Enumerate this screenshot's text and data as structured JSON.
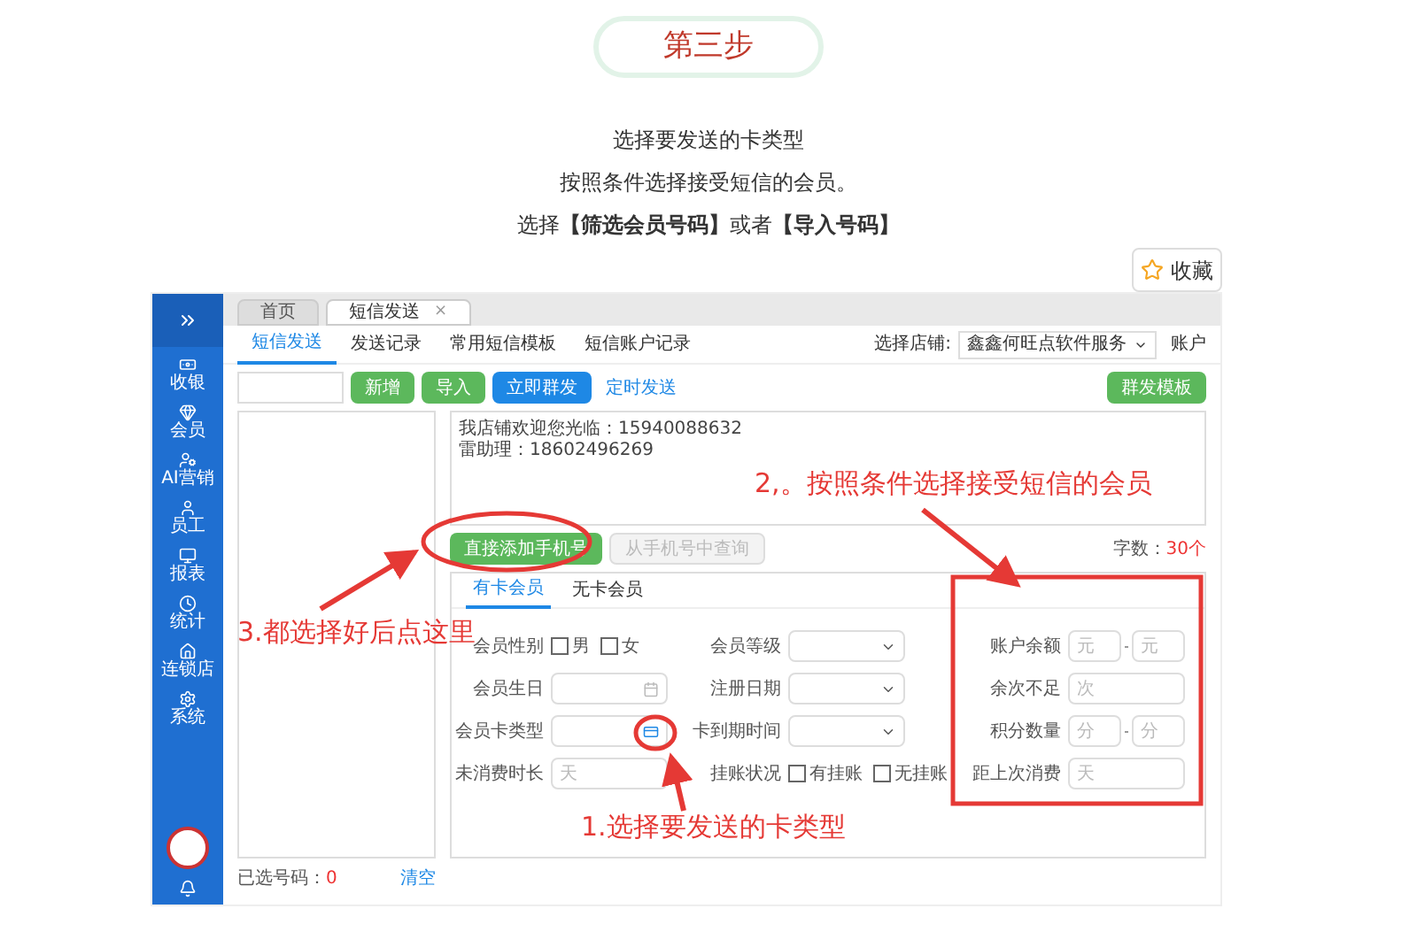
{
  "step_badge": {
    "label": "第三步"
  },
  "instructions": [
    "选择要发送的卡类型",
    "按照条件选择接受短信的会员。",
    "选择**【筛选会员号码】**或者**【导入号码】**"
  ],
  "favorite_button": {
    "label": "收藏"
  },
  "screenshot": {
    "sidebar": [
      "收银",
      "会员",
      "AI营销",
      "员工",
      "报表",
      "统计",
      "连锁店",
      "系统"
    ],
    "tabs": [
      {
        "label": "首页",
        "selected": false
      },
      {
        "label": "短信发送",
        "selected": true,
        "close": "×"
      }
    ],
    "sub_tabs": [
      {
        "label": "短信发送",
        "selected": true
      },
      {
        "label": "发送记录",
        "selected": false
      },
      {
        "label": "常用短信模板",
        "selected": false
      },
      {
        "label": "短信账户记录",
        "selected": false
      }
    ],
    "store_label": "选择店铺:",
    "store_value": "鑫鑫何旺点软件服务",
    "account_label": "账户",
    "toolbar_buttons": [
      {
        "label": "新增",
        "kind": "green"
      },
      {
        "label": "导入",
        "kind": "green"
      },
      {
        "label": "立即群发",
        "kind": "blue"
      },
      {
        "label": "定时发送",
        "kind": "link"
      }
    ],
    "template_button": {
      "label": "群发模板"
    },
    "message_lines": [
      "我店铺欢迎您光临：15940088632",
      "雷助理：18602496269"
    ],
    "add_buttons": [
      {
        "label": "直接添加手机号",
        "disabled": false
      },
      {
        "label": "从手机号中查询",
        "disabled": true
      }
    ],
    "char_count_label": "字数：",
    "char_count": "30个",
    "member_tabs": [
      {
        "label": "有卡会员",
        "selected": true
      },
      {
        "label": "无卡会员",
        "selected": false
      }
    ],
    "form_columns": [
      [
        {
          "kind": "checkboxes",
          "label": "会员性别",
          "options": [
            {
              "label": "男",
              "checked": false
            },
            {
              "label": "女",
              "checked": false
            }
          ]
        },
        {
          "kind": "date",
          "label": "会员生日"
        },
        {
          "kind": "picker",
          "label": "会员卡类型"
        },
        {
          "kind": "text",
          "label": "未消费时长",
          "placeholder": "天"
        }
      ],
      [
        {
          "kind": "select",
          "label": "会员等级"
        },
        {
          "kind": "select",
          "label": "注册日期"
        },
        {
          "kind": "select",
          "label": "卡到期时间"
        },
        {
          "kind": "checkboxes",
          "label": "挂账状况",
          "options": [
            {
              "label": "有挂账",
              "checked": false
            },
            {
              "label": "无挂账",
              "checked": false
            }
          ]
        }
      ],
      [
        {
          "kind": "range",
          "label": "账户余额",
          "placeholder": "元",
          "placeholder2": "元"
        },
        {
          "kind": "text",
          "label": "余次不足",
          "placeholder": "次"
        },
        {
          "kind": "range",
          "label": "积分数量",
          "placeholder": "分",
          "placeholder2": "分"
        },
        {
          "kind": "text",
          "label": "距上次消费",
          "placeholder": "天"
        }
      ]
    ],
    "selected_count_label": "已选号码：",
    "selected_count": "0",
    "clear_link": {
      "label": "清空"
    }
  },
  "annotations": [
    "2,。按照条件选择接受短信的会员",
    "3.都选择好后点这里",
    "1.选择要发送的卡类型"
  ]
}
